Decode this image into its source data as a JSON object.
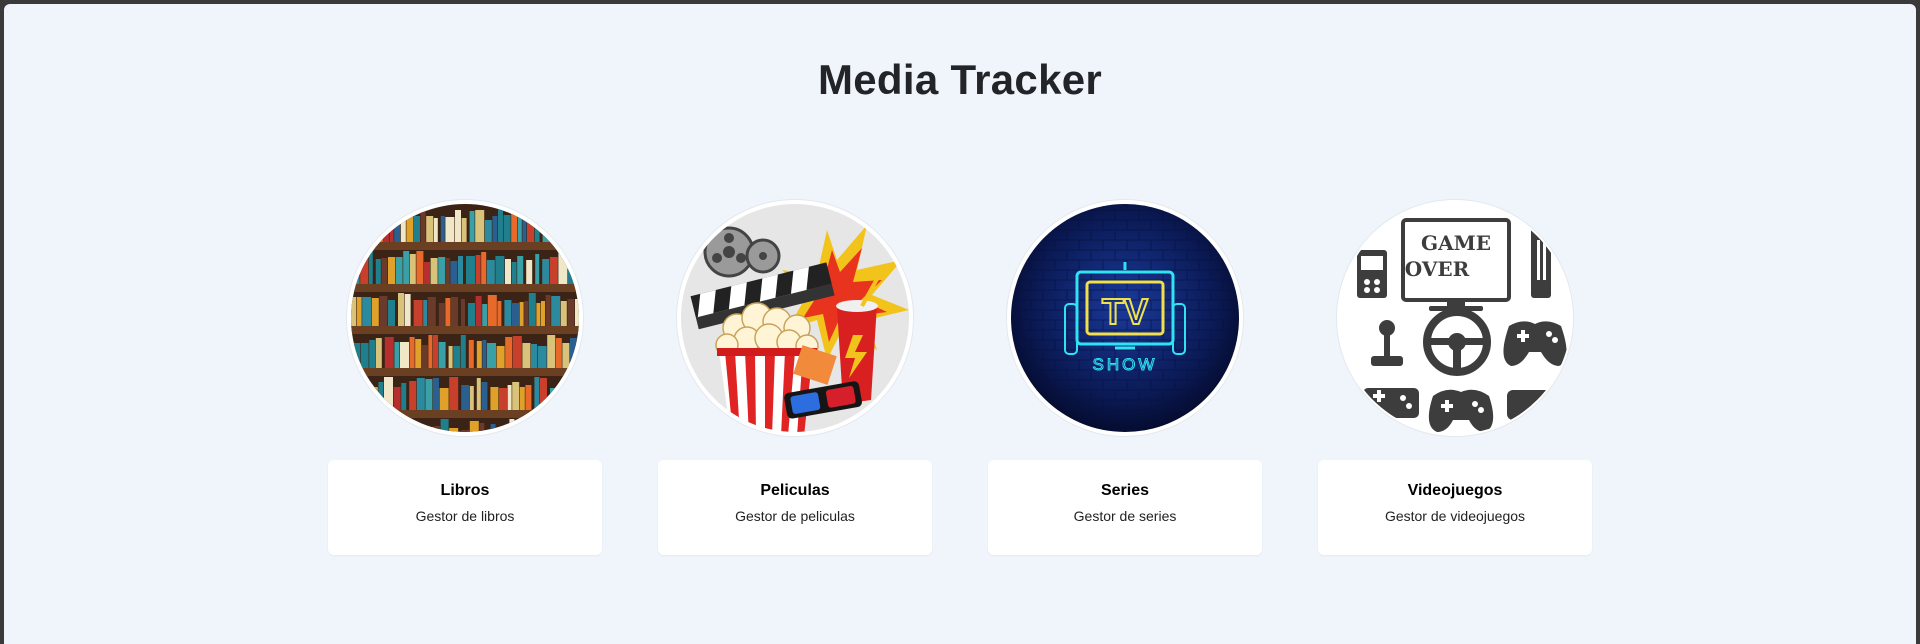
{
  "page": {
    "title": "Media Tracker"
  },
  "cards": [
    {
      "title": "Libros",
      "description": "Gestor de libros",
      "icon": "bookshelf-icon"
    },
    {
      "title": "Peliculas",
      "description": "Gestor de peliculas",
      "icon": "cinema-popcorn-icon"
    },
    {
      "title": "Series",
      "description": "Gestor de series",
      "icon": "tv-show-neon-icon",
      "image_text": {
        "tv": "TV",
        "show": "SHOW"
      }
    },
    {
      "title": "Videojuegos",
      "description": "Gestor de videojuegos",
      "icon": "game-over-icon",
      "image_text": {
        "line1": "GAME",
        "line2": "OVER"
      }
    }
  ],
  "colors": {
    "background": "#f0f5fc",
    "card_background": "#ffffff",
    "title_text": "#222428",
    "neon_yellow": "#f1e04a",
    "neon_cyan": "#2fe3f5",
    "tv_background": "#0b1a55"
  }
}
